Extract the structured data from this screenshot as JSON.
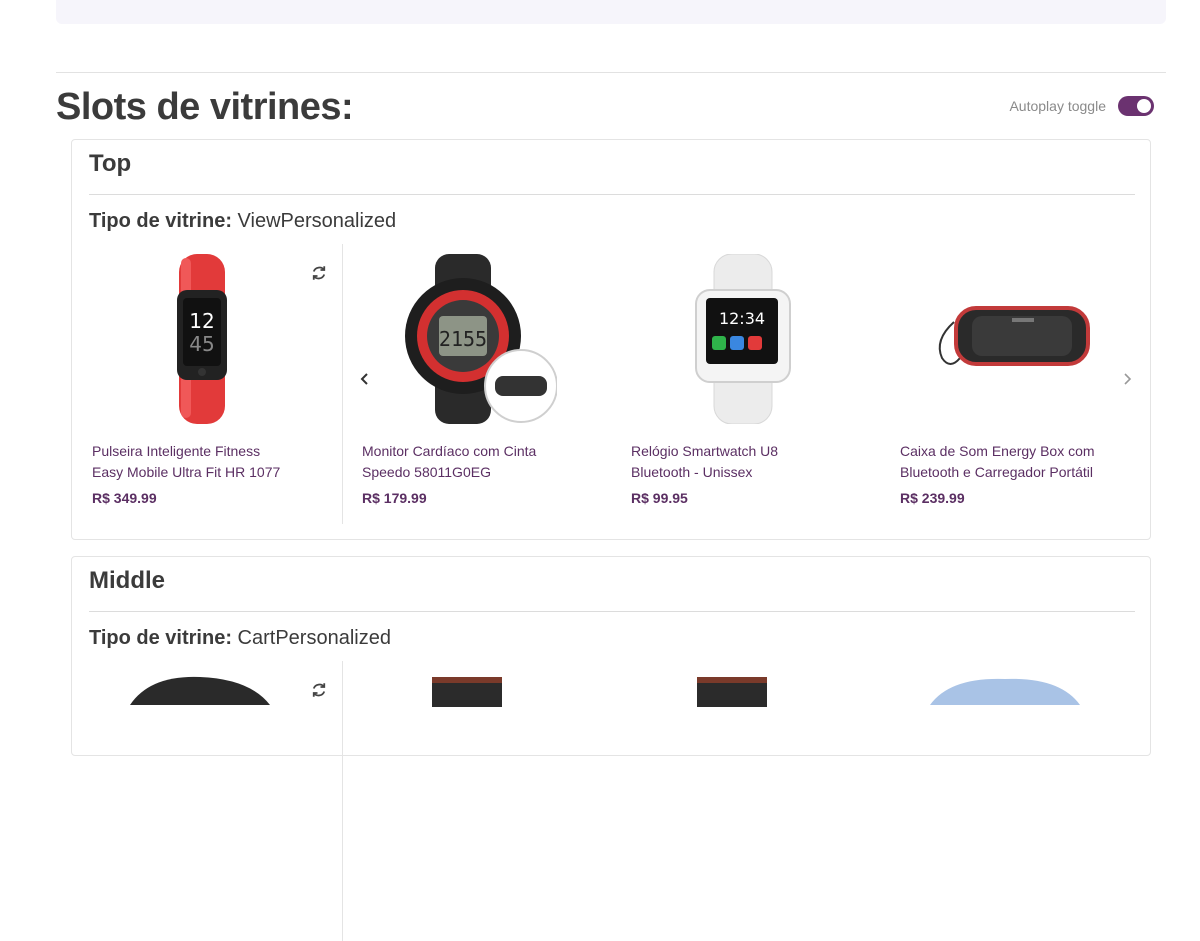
{
  "page": {
    "title": "Slots de vitrines:",
    "autoplay_label": "Autoplay toggle",
    "autoplay_on": true,
    "accent_color": "#6b3270"
  },
  "slots": [
    {
      "name": "Top",
      "type_label": "Tipo de vitrine:",
      "type_value": "ViewPersonalized",
      "products": [
        {
          "name": "Pulseira Inteligente Fitness Easy Mobile Ultra Fit HR 1077",
          "price": "R$ 349.99",
          "icon": "fitness-band"
        },
        {
          "name": "Monitor Cardíaco com Cinta Speedo 58011G0EG",
          "price": "R$ 179.99",
          "icon": "heart-monitor-watch"
        },
        {
          "name": "Relógio Smartwatch U8 Bluetooth - Unissex",
          "price": "R$ 99.95",
          "icon": "smartwatch"
        },
        {
          "name": "Caixa de Som Energy Box com Bluetooth e Carregador Portátil",
          "price": "R$ 239.99",
          "icon": "bluetooth-speaker"
        }
      ]
    },
    {
      "name": "Middle",
      "type_label": "Tipo de vitrine:",
      "type_value": "CartPersonalized",
      "products": [
        {
          "icon": "fitness-band"
        },
        {
          "icon": "shorts"
        },
        {
          "icon": "shorts"
        },
        {
          "icon": "backpack"
        }
      ]
    }
  ]
}
